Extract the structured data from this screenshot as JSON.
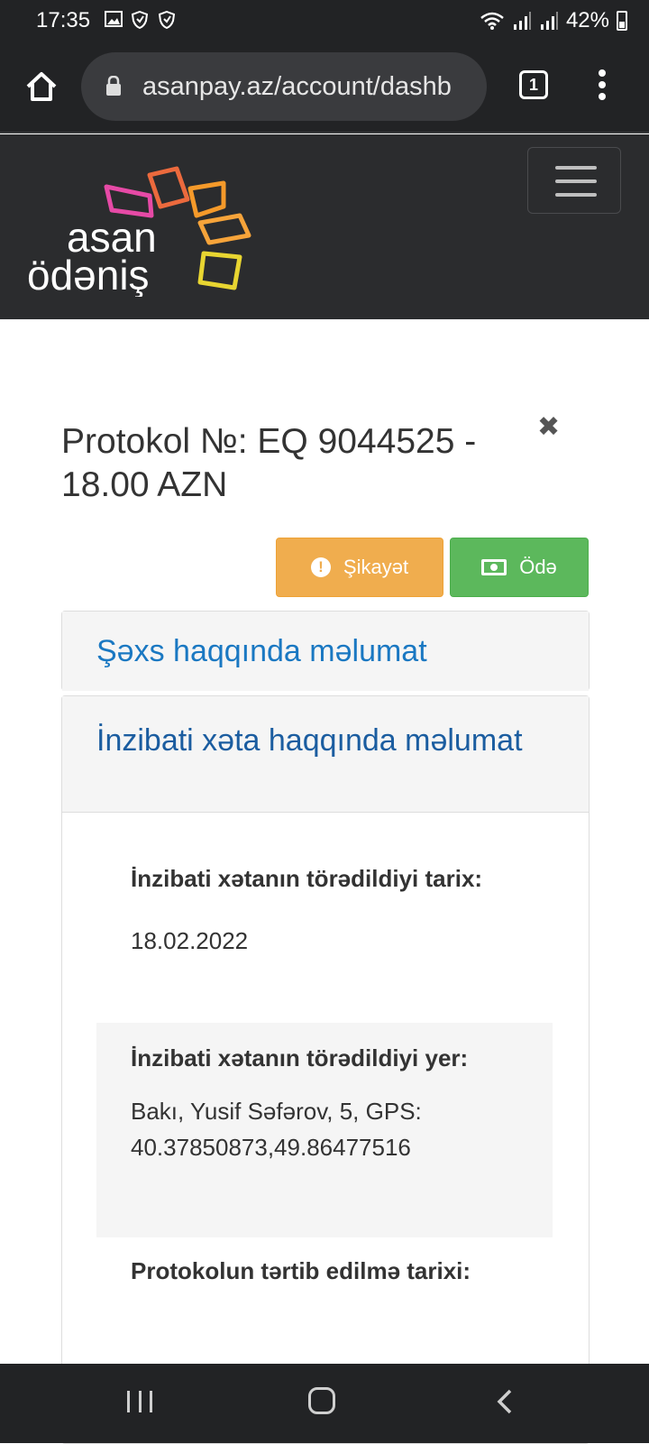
{
  "status_bar": {
    "time": "17:35",
    "battery": "42%",
    "icons": [
      "image-icon",
      "shield-icon",
      "shield-icon",
      "wifi-icon",
      "signal-icon",
      "signal-icon",
      "battery-icon"
    ]
  },
  "browser": {
    "url": "asanpay.az/account/dashb",
    "tab_count": "1"
  },
  "site": {
    "logo_line1": "asan",
    "logo_line2": "ödəniş"
  },
  "protocol": {
    "title": "Protokol №: EQ 9044525 - 18.00 AZN",
    "complaint_label": "Şikayət",
    "pay_label": "Ödə"
  },
  "panels": [
    {
      "heading": "Şəxs haqqında məlumat"
    },
    {
      "heading": "İnzibati xəta haqqında məlumat"
    }
  ],
  "fields": [
    {
      "label": "İnzibati xətanın törədildiyi tarix:",
      "value": "18.02.2022"
    },
    {
      "label": "İnzibati xətanın törədildiyi yer:",
      "value": "Bakı, Yusif Səfərov, 5, GPS: 40.37850873,49.86477516"
    },
    {
      "label": "Protokolun tərtib edilmə tarixi:",
      "value": ""
    }
  ],
  "colors": {
    "complaint_button": "#f0ad4e",
    "pay_button": "#5cb85c",
    "panel_heading_link": "#1a78c2",
    "header_bg": "#2b2c2e"
  }
}
